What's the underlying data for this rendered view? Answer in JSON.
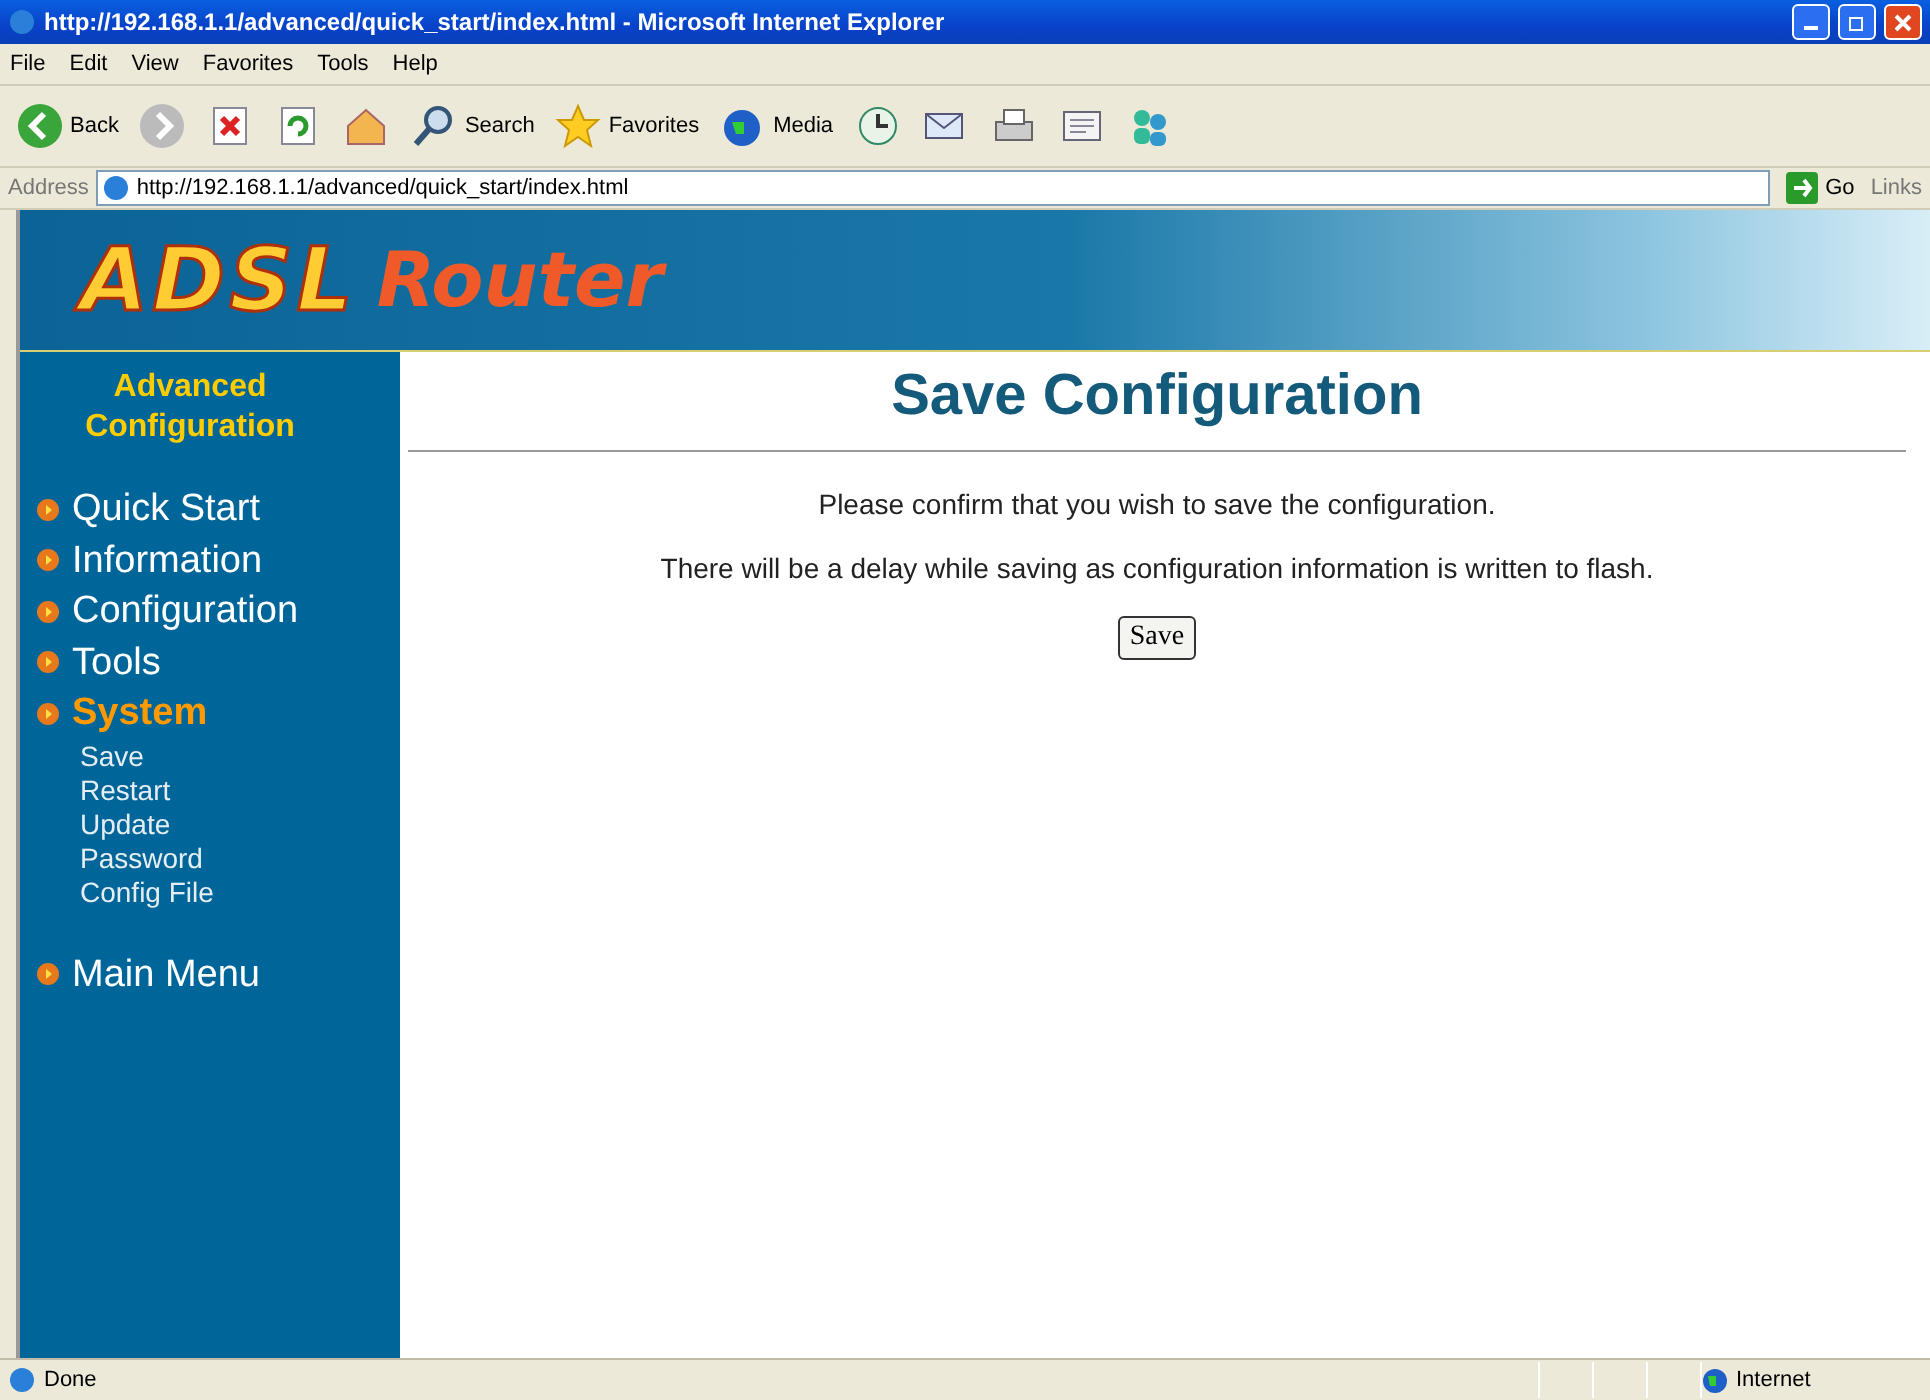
{
  "window": {
    "title": "http://192.168.1.1/advanced/quick_start/index.html - Microsoft Internet Explorer"
  },
  "menu": [
    "File",
    "Edit",
    "View",
    "Favorites",
    "Tools",
    "Help"
  ],
  "toolbar": [
    {
      "kind": "back",
      "label": "Back"
    },
    {
      "kind": "forward"
    },
    {
      "kind": "stop"
    },
    {
      "kind": "refresh"
    },
    {
      "kind": "home"
    },
    {
      "kind": "search",
      "label": "Search"
    },
    {
      "kind": "favorites",
      "label": "Favorites"
    },
    {
      "kind": "media",
      "label": "Media"
    },
    {
      "kind": "history"
    },
    {
      "kind": "mail"
    },
    {
      "kind": "print"
    },
    {
      "kind": "edit"
    },
    {
      "kind": "people"
    }
  ],
  "address": {
    "label": "Address",
    "url": "http://192.168.1.1/advanced/quick_start/index.html",
    "go": "Go",
    "links": "Links"
  },
  "banner": {
    "logo_main": "ADSL",
    "logo_sub": "Router"
  },
  "sidebar": {
    "heading": "Advanced Configuration",
    "items": [
      {
        "label": "Quick Start",
        "selected": false
      },
      {
        "label": "Information",
        "selected": false
      },
      {
        "label": "Configuration",
        "selected": false
      },
      {
        "label": "Tools",
        "selected": false
      },
      {
        "label": "System",
        "selected": true,
        "children": [
          "Save",
          "Restart",
          "Update",
          "Password",
          "Config File"
        ]
      }
    ],
    "footer_item": {
      "label": "Main Menu",
      "selected": false
    }
  },
  "content": {
    "title": "Save Configuration",
    "paragraphs": [
      "Please confirm that you wish to save the configuration.",
      "There will be a delay while saving as configuration information is written to flash."
    ],
    "button": "Save"
  },
  "status_bar": {
    "text": "Done",
    "zone": "Internet"
  }
}
